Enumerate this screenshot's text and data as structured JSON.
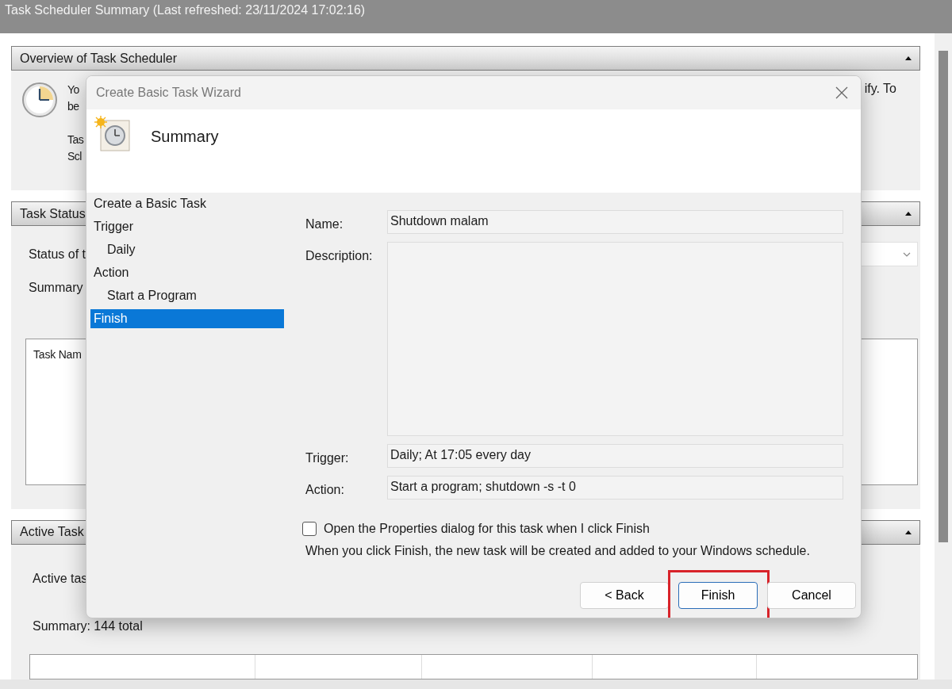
{
  "window": {
    "title": "Task Scheduler Summary (Last refreshed: 23/11/2024 17:02:16)"
  },
  "overview": {
    "title": "Overview of Task Scheduler",
    "expanded": true,
    "text_left": [
      "Yo",
      "be",
      "Tas",
      "Scl"
    ],
    "text_right": "ify. To"
  },
  "task_status": {
    "title": "Task Status",
    "expanded": true,
    "status_label": "Status of t",
    "summary_label": "Summary",
    "list_header": "Task Nam"
  },
  "active_tasks": {
    "title": "Active Task",
    "expanded": true,
    "active_label": "Active tas",
    "summary": "Summary: 144 total"
  },
  "dialog": {
    "title": "Create Basic Task Wizard",
    "heading": "Summary",
    "steps": [
      {
        "label": "Create a Basic Task",
        "selected": false
      },
      {
        "label": "Trigger",
        "selected": false,
        "children": [
          {
            "label": "Daily",
            "selected": false
          }
        ]
      },
      {
        "label": "Action",
        "selected": false,
        "children": [
          {
            "label": "Start a Program",
            "selected": false
          }
        ]
      },
      {
        "label": "Finish",
        "selected": true
      }
    ],
    "fields": [
      {
        "label": "Name:",
        "kind": "line",
        "value": "Shutdown malam"
      },
      {
        "label": "Description:",
        "kind": "area"
      },
      {
        "label": "Trigger:",
        "kind": "line",
        "value": "Daily; At 17:05 every day"
      },
      {
        "label": "Action:",
        "kind": "line",
        "value": "Start a program; shutdown -s -t 0"
      }
    ],
    "checkbox": {
      "label": "Open the Properties dialog for this task when I click Finish",
      "checked": false
    },
    "note": "When you click Finish, the new task will be created and added to your Windows schedule.",
    "buttons": [
      {
        "label": "< Back",
        "default": false,
        "highlighted": false
      },
      {
        "label": "Finish",
        "default": true,
        "highlighted": true
      },
      {
        "label": "Cancel",
        "default": false,
        "highlighted": false
      }
    ]
  }
}
